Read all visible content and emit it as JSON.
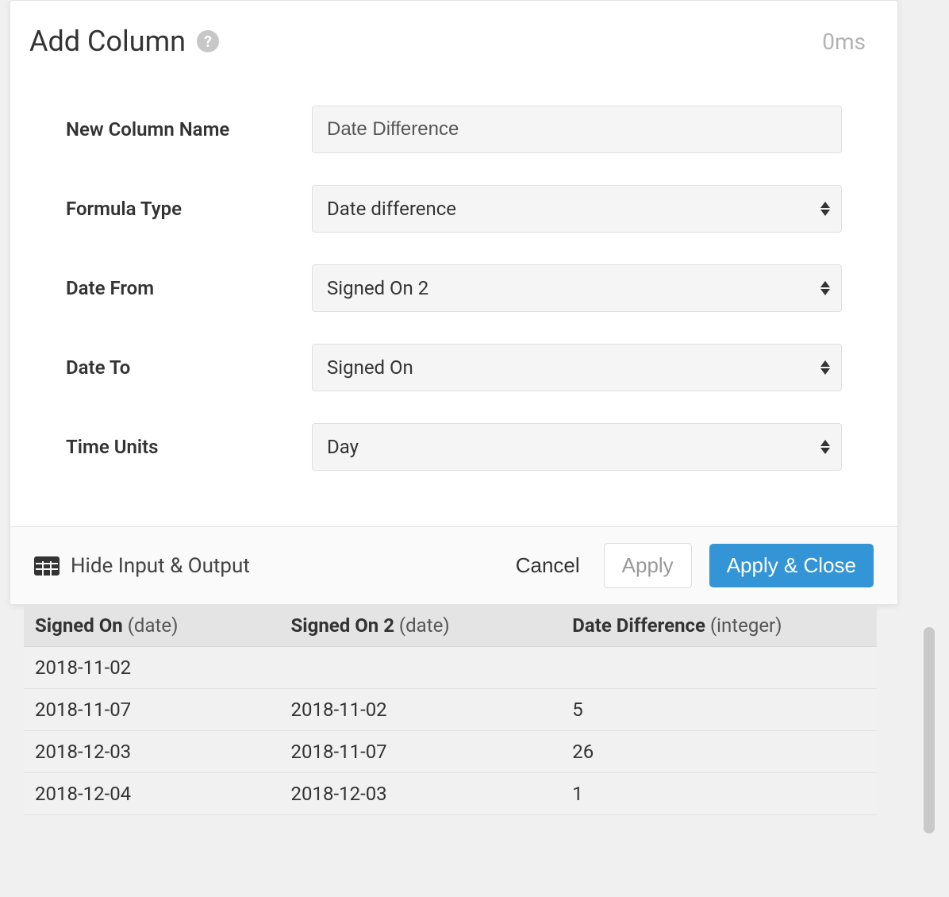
{
  "header": {
    "title": "Add Column",
    "timing": "0ms"
  },
  "form": {
    "new_column_name_label": "New Column Name",
    "new_column_name_value": "Date Difference",
    "formula_type_label": "Formula Type",
    "formula_type_value": "Date difference",
    "date_from_label": "Date From",
    "date_from_value": "Signed On 2",
    "date_to_label": "Date To",
    "date_to_value": "Signed On",
    "time_units_label": "Time Units",
    "time_units_value": "Day"
  },
  "footer": {
    "hide_io_label": "Hide Input & Output",
    "cancel_label": "Cancel",
    "apply_label": "Apply",
    "apply_close_label": "Apply & Close"
  },
  "table": {
    "columns": [
      {
        "name": "Signed On",
        "type": "(date)"
      },
      {
        "name": "Signed On 2",
        "type": "(date)"
      },
      {
        "name": "Date Difference",
        "type": "(integer)"
      }
    ],
    "rows": [
      {
        "c0": "2018-11-02",
        "c1": "",
        "c2": ""
      },
      {
        "c0": "2018-11-07",
        "c1": "2018-11-02",
        "c2": "5"
      },
      {
        "c0": "2018-12-03",
        "c1": "2018-11-07",
        "c2": "26"
      },
      {
        "c0": "2018-12-04",
        "c1": "2018-12-03",
        "c2": "1"
      }
    ]
  }
}
